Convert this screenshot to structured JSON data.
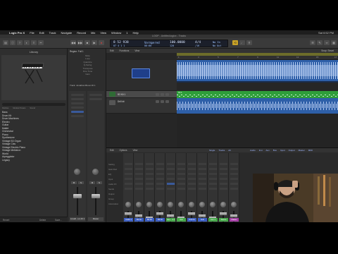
{
  "menubar": {
    "app_name": "Logic Pro X",
    "items": [
      "File",
      "Edit",
      "Track",
      "Navigate",
      "Record",
      "Mix",
      "View",
      "Window",
      "1",
      "Help"
    ],
    "clock": "Sat 6:52 PM"
  },
  "window": {
    "title": "LOOP - Untitled.logicx - Tracks"
  },
  "transport": {
    "position": "8 52 938",
    "position_sub": "07   4   1   1",
    "display_mode": "Vermpered",
    "time": "00:00",
    "tempo": "100.0000",
    "signature": "4/4",
    "key": "No In",
    "key_sub": "No Out",
    "bpm_label": "120",
    "division": "/16"
  },
  "library": {
    "title": "Library",
    "columns": [
      "Patches",
      "Module Presets",
      "Sound"
    ],
    "items": [
      "Bass",
      "Drum Kit",
      "Drum Machines",
      "Electro",
      "Guitar",
      "Mallet",
      "Orchestral",
      "Piano",
      "Synthesizer",
      "Vintage B3 Organ",
      "Vintage Clav",
      "Vintage Electric Piano",
      "Vintage Mellotron",
      "World",
      "Arpeggiator",
      "Legacy"
    ],
    "footer": [
      "Revert",
      "Delete",
      "Save..."
    ]
  },
  "inspector": {
    "region_header": "Region: Full 1",
    "params": [
      "Mute",
      "Loop",
      "Quantize",
      "Q-Swing",
      "Transpose",
      "Fine Tune",
      "Gain"
    ],
    "track_header": "Track: Jonathan Broon DI 1",
    "strips": [
      {
        "name": "Jonath...ion DI 1",
        "ms": [
          "M",
          "S"
        ]
      },
      {
        "name": "Master",
        "ms": [
          "M",
          "S"
        ]
      }
    ]
  },
  "tracks_area": {
    "menu": [
      "Edit",
      "Functions",
      "View"
    ],
    "menu_right": "Snap: Smart",
    "ruler_ticks": [
      "1",
      "3",
      "5",
      "7",
      "9",
      "11",
      "13",
      "15",
      "17"
    ],
    "tracks": [
      {
        "name": "",
        "region": "Jonathan Broon 2"
      },
      {
        "name": "B3 Kit 1",
        "region": "Kit 1"
      },
      {
        "name": "Drill kit",
        "region": "Jonathan Broon 2"
      }
    ]
  },
  "mixer": {
    "menu": [
      "Edit",
      "Options",
      "View"
    ],
    "tabs": [
      "Single",
      "Tracks",
      "All"
    ],
    "filters": [
      "Audio",
      "Inst",
      "Aux",
      "Bus",
      "Input",
      "Output",
      "Master",
      "MIDI"
    ],
    "row_labels": [
      "Setting",
      "Gain Red",
      "EQ",
      "Input",
      "Audio FX",
      "Sends",
      "Output",
      "Group",
      "Automation"
    ],
    "strips": [
      {
        "name": "Audio 1",
        "color": "#3c5fc4"
      },
      {
        "name": "B3 Kit",
        "color": "#3c5fc4"
      },
      {
        "name": "B3 Kit",
        "color": "#3c5fc4"
      },
      {
        "name": "B3 Kit",
        "color": "#3c5fc4"
      },
      {
        "name": "Aux... 4 1",
        "color": "#46a84a"
      },
      {
        "name": "Aux",
        "color": "#46a84a"
      },
      {
        "name": "Drill Kit",
        "color": "#3c5fc4"
      },
      {
        "name": "Drill",
        "color": "#3c5fc4"
      },
      {
        "name": "Aux 1",
        "color": "#46a84a"
      },
      {
        "name": "Stereo",
        "color": "#46a84a"
      },
      {
        "name": "Master",
        "color": "#a43ca4"
      }
    ]
  },
  "colors": {
    "audio_region": "#2e5fa8",
    "midi_region": "#2f9e3a",
    "cycle": "#6d6d2a"
  }
}
